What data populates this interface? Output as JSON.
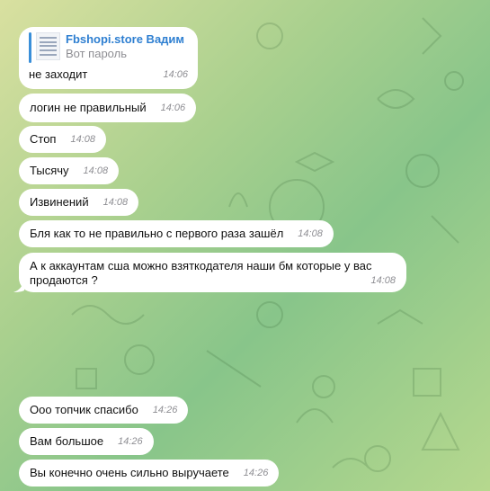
{
  "chat": {
    "reply": {
      "sender": "Fbshopi.store Вадим",
      "quoted_text": "Вот пароль"
    },
    "messages": [
      {
        "text": "не заходит",
        "time": "14:06"
      },
      {
        "text": "логин не правильный",
        "time": "14:06"
      },
      {
        "text": "Стоп",
        "time": "14:08"
      },
      {
        "text": "Тысячу",
        "time": "14:08"
      },
      {
        "text": "Извинений",
        "time": "14:08"
      },
      {
        "text": "Бля как то не правильно с первого раза зашёл",
        "time": "14:08"
      },
      {
        "text_line1": "А к аккаунтам сша можно взяткодателя наши бм которые у вас",
        "text_line2": "продаются ?",
        "time": "14:08"
      },
      {
        "text": "Ооо топчик спасибо",
        "time": "14:26"
      },
      {
        "text": "Вам большое",
        "time": "14:26"
      },
      {
        "text": "Вы конечно очень сильно выручаете",
        "time": "14:26"
      }
    ]
  },
  "colors": {
    "bubble": "#ffffff",
    "reply_accent": "#3a8fd9",
    "time": "#8e8e93"
  },
  "icons": [
    "document-thumbnail-icon",
    "doodle-wallpaper"
  ]
}
